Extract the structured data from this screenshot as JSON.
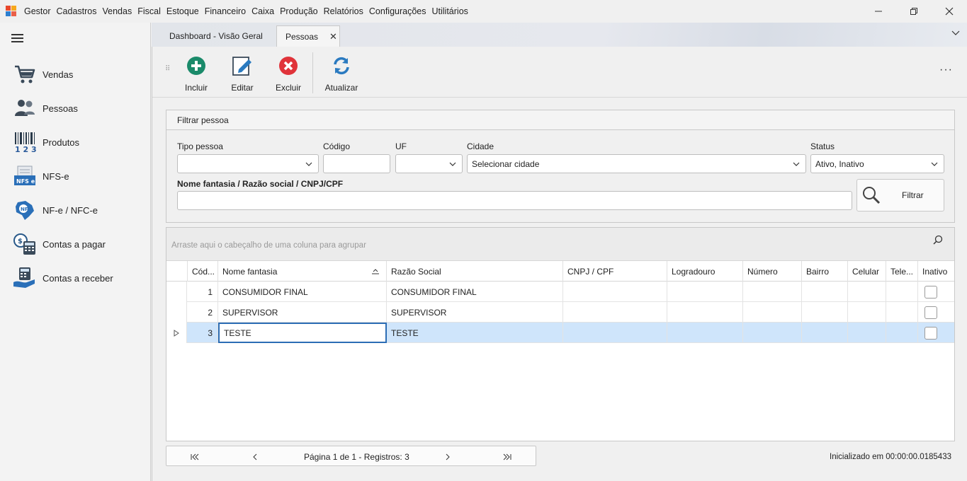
{
  "menu": {
    "app_name": "Gestor",
    "items": [
      "Cadastros",
      "Vendas",
      "Fiscal",
      "Estoque",
      "Financeiro",
      "Caixa",
      "Produção",
      "Relatórios",
      "Configurações",
      "Utilitários"
    ]
  },
  "sidebar": {
    "items": [
      {
        "label": "Vendas",
        "icon": "shopping-cart-icon"
      },
      {
        "label": "Pessoas",
        "icon": "people-icon"
      },
      {
        "label": "Produtos",
        "icon": "barcode-icon"
      },
      {
        "label": "NFS-e",
        "icon": "nfse-document-icon"
      },
      {
        "label": "NF-e / NFC-e",
        "icon": "nfe-brazil-icon"
      },
      {
        "label": "Contas a pagar",
        "icon": "calculator-coin-icon"
      },
      {
        "label": "Contas a receber",
        "icon": "receivable-calculator-icon"
      }
    ]
  },
  "tabs": [
    {
      "label": "Dashboard - Visão Geral",
      "active": false
    },
    {
      "label": "Pessoas",
      "active": true
    }
  ],
  "toolbar": {
    "incluir": "Incluir",
    "editar": "Editar",
    "excluir": "Excluir",
    "atualizar": "Atualizar"
  },
  "filter": {
    "title": "Filtrar pessoa",
    "tipo_pessoa_label": "Tipo pessoa",
    "tipo_pessoa_value": "",
    "codigo_label": "Código",
    "codigo_value": "",
    "uf_label": "UF",
    "uf_value": "",
    "cidade_label": "Cidade",
    "cidade_value": "Selecionar cidade",
    "status_label": "Status",
    "status_value": "Ativo, Inativo",
    "nome_label": "Nome fantasia / Razão social / CNPJ/CPF",
    "nome_value": "",
    "filtrar_label": "Filtrar"
  },
  "grid": {
    "group_hint": "Arraste aqui o cabeçalho de uma coluna para agrupar",
    "columns": [
      "Cód...",
      "Nome fantasia",
      "Razão Social",
      "CNPJ / CPF",
      "Logradouro",
      "Número",
      "Bairro",
      "Celular",
      "Tele...",
      "Inativo"
    ],
    "rows": [
      {
        "codigo": "1",
        "nome": "CONSUMIDOR FINAL",
        "razao": "CONSUMIDOR FINAL",
        "cnpj": "",
        "logradouro": "",
        "numero": "",
        "bairro": "",
        "celular": "",
        "telefone": "",
        "inativo": false
      },
      {
        "codigo": "2",
        "nome": "SUPERVISOR",
        "razao": "SUPERVISOR",
        "cnpj": "",
        "logradouro": "",
        "numero": "",
        "bairro": "",
        "celular": "",
        "telefone": "",
        "inativo": false
      },
      {
        "codigo": "3",
        "nome": "TESTE",
        "razao": "TESTE",
        "cnpj": "",
        "logradouro": "",
        "numero": "",
        "bairro": "",
        "celular": "",
        "telefone": "",
        "inativo": false
      }
    ],
    "selected_row": 3
  },
  "pager": {
    "text": "Página 1 de 1 - Registros: 3"
  },
  "status": {
    "init_time": "Inicializado em 00:00:00.0185433"
  },
  "colors": {
    "accent_green": "#1a8a6a",
    "accent_red": "#e0333a",
    "accent_blue": "#2a7ac0",
    "selected_row": "#cfe5fb"
  }
}
